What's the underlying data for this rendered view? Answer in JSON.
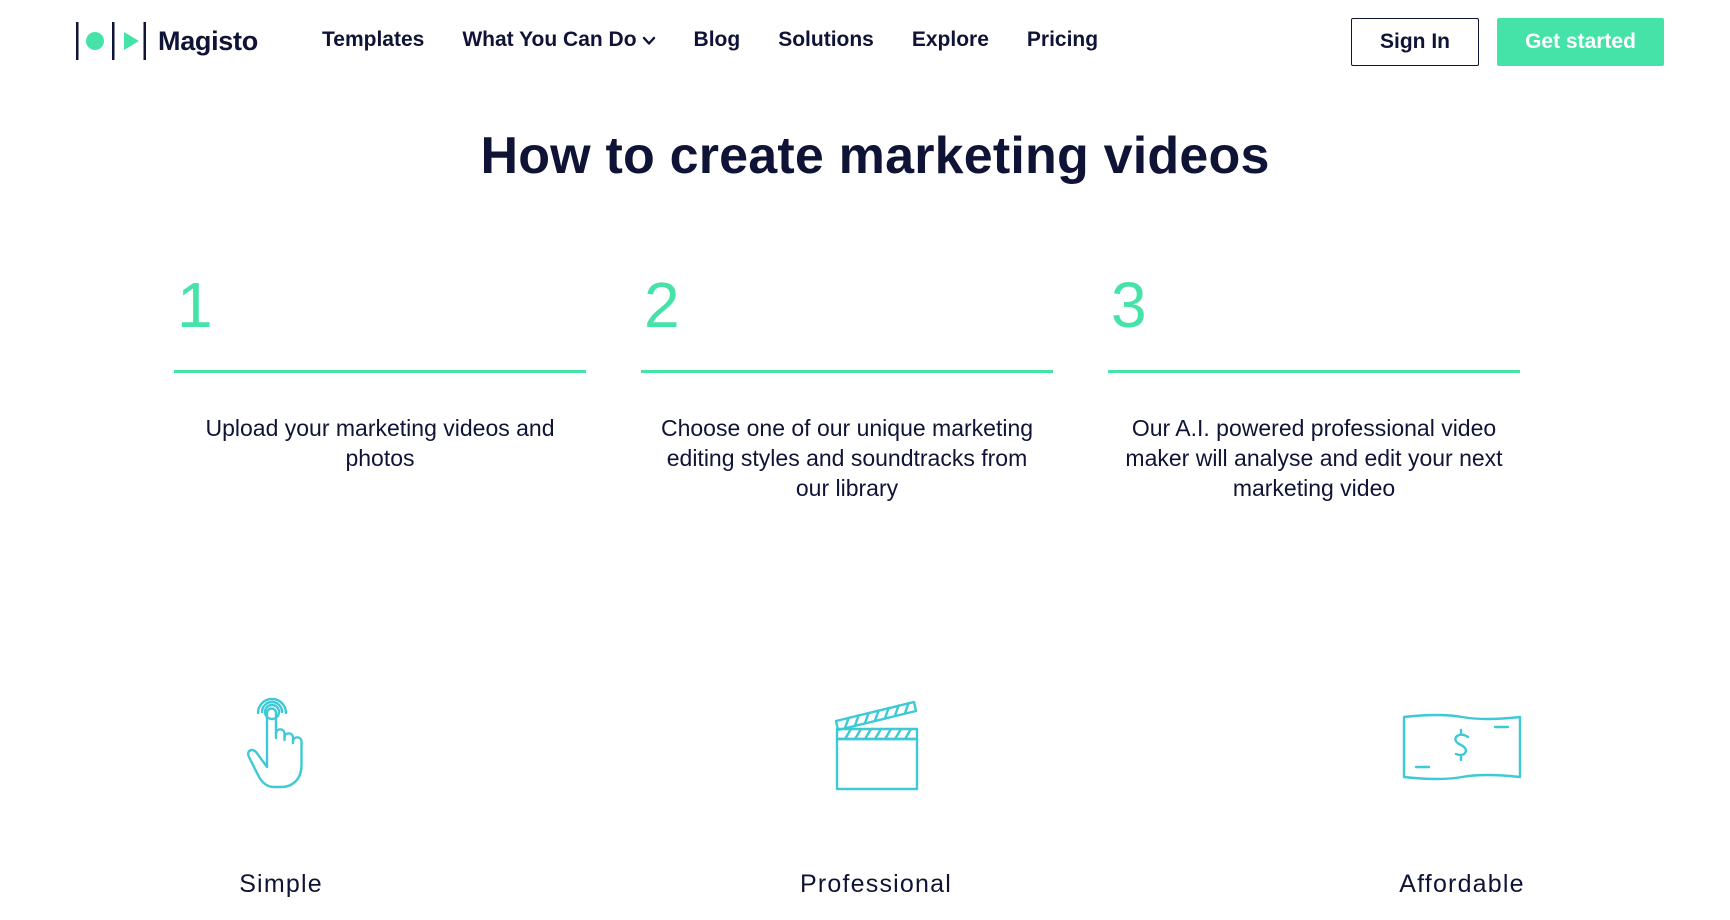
{
  "brand": {
    "name": "Magisto",
    "accent": "#46e3a9",
    "icon_color": "#3ec9d6",
    "text_color": "#0f1436"
  },
  "nav": {
    "items": [
      {
        "label": "Templates"
      },
      {
        "label": "What You Can Do",
        "has_dropdown": true,
        "icon": "chevron-down-icon"
      },
      {
        "label": "Blog"
      },
      {
        "label": "Solutions"
      },
      {
        "label": "Explore"
      },
      {
        "label": "Pricing"
      }
    ],
    "sign_in": "Sign In",
    "get_started": "Get started"
  },
  "main": {
    "title": "How to create marketing videos",
    "steps": [
      {
        "number": "1",
        "text": "Upload your marketing videos and photos"
      },
      {
        "number": "2",
        "text": "Choose one of our unique marketing editing styles and soundtracks from our library"
      },
      {
        "number": "3",
        "text": "Our A.I. powered professional video maker will analyse and edit your next marketing video"
      }
    ],
    "features": [
      {
        "label": "Simple",
        "icon": "hand-tap-icon"
      },
      {
        "label": "Professional",
        "icon": "clapperboard-icon"
      },
      {
        "label": "Affordable",
        "icon": "banknote-icon"
      }
    ]
  }
}
